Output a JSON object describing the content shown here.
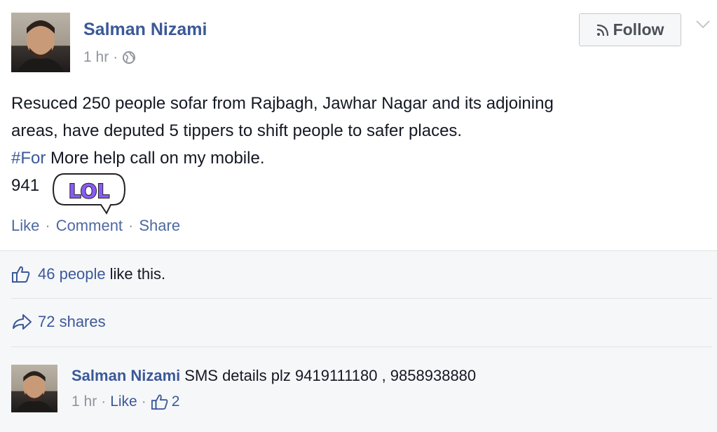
{
  "post": {
    "author": "Salman Nizami",
    "time": "1 hr",
    "follow_label": "Follow",
    "lines": [
      "Resuced 250 people sofar from Rajbagh, Jawhar Nagar and its adjoining",
      "areas, have deputed 5 tippers to shift people to safer places."
    ],
    "hashtag": "#For",
    "line3_rest": " More help call on my mobile.",
    "phone_start": "941",
    "phone_end": ").",
    "sticker_text": "LOL",
    "actions": {
      "like": "Like",
      "comment": "Comment",
      "share": "Share"
    }
  },
  "ufi": {
    "likes_link": "46 people",
    "likes_rest": "like this.",
    "shares": "72 shares"
  },
  "comment": {
    "author": "Salman Nizami",
    "text": "SMS details plz 9419111180 , 9858938880",
    "time": "1 hr",
    "like_label": "Like",
    "like_count": "2"
  },
  "colors": {
    "link_blue": "#3b5998",
    "meta_gray": "#90949c",
    "sticker_purple": "#8a5cf6"
  },
  "icons": [
    "globe-icon",
    "rss-icon",
    "chevron-down-icon",
    "thumbs-up-icon",
    "share-arrow-icon"
  ]
}
